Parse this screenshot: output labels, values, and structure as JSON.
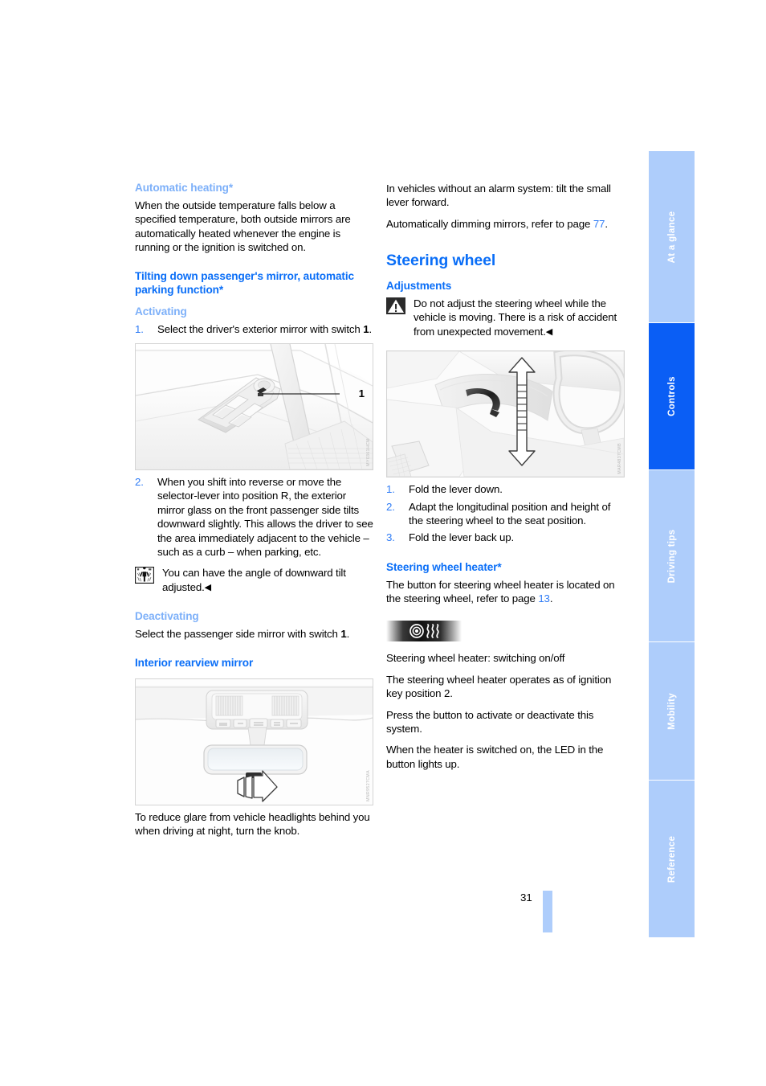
{
  "document": {
    "page_number": "31"
  },
  "tabs": [
    {
      "label": "At a glance",
      "active": false
    },
    {
      "label": "Controls",
      "active": true
    },
    {
      "label": "Driving tips",
      "active": false
    },
    {
      "label": "Mobility",
      "active": false
    },
    {
      "label": "Reference",
      "active": false
    }
  ],
  "left_column": {
    "automatic_heating": {
      "heading": "Automatic heating*",
      "body": "When the outside temperature falls below a specified temperature, both outside mirrors are automatically heated whenever the engine is running or the ignition is switched on."
    },
    "tilting": {
      "heading": "Tilting down passenger's mirror, automatic parking function*",
      "activating_heading": "Activating",
      "step1_pre": "Select the driver's exterior mirror with switch ",
      "step1_bold": "1",
      "step1_post": ".",
      "figure1_code": "MY0361HCM",
      "figure1_callout": "1",
      "step2": "When you shift into reverse or move the selector-lever into position R, the exterior mirror glass on the front passenger side tilts downward slightly. This allows the driver to see the area immediately adjacent to the vehicle – such as a curb – when parking, etc.",
      "note": "You can have the angle of downward tilt adjusted.",
      "note_icon": "service-dealer-icon",
      "deactivating_heading": "Deactivating",
      "deactivating_pre": "Select the passenger side mirror with switch ",
      "deactivating_bold": "1",
      "deactivating_post": "."
    },
    "interior_mirror": {
      "heading": "Interior rearview mirror",
      "figure2_code": "MNR9527CMA",
      "caption": "To reduce glare from vehicle headlights behind you when driving at night, turn the knob."
    }
  },
  "right_column": {
    "intro": {
      "para1": "In vehicles without an alarm system: tilt the small lever forward.",
      "para2_pre": "Automatically dimming mirrors, refer to page ",
      "para2_ref": "77",
      "para2_post": "."
    },
    "steering_wheel": {
      "title": "Steering wheel",
      "adjustments_heading": "Adjustments",
      "warning": "Do not adjust the steering wheel while the vehicle is moving. There is a risk of accident from unexpected movement.",
      "warning_icon": "warning-triangle-icon",
      "figure_code": "MAR4837CMB",
      "steps": [
        "Fold the lever down.",
        "Adapt the longitudinal position and height of the steering wheel to the seat position.",
        "Fold the lever back up."
      ]
    },
    "steering_wheel_heater": {
      "heading": "Steering wheel heater*",
      "intro_pre": "The button for steering wheel heater is located on the steering wheel, refer to page ",
      "intro_ref": "13",
      "intro_post": ".",
      "button_icon": "steering-wheel-heater-icon",
      "caption": "Steering wheel heater: switching on/off",
      "para1": "The steering wheel heater operates as of ignition key position 2.",
      "para2": "Press the button to activate or deactivate this system.",
      "para3": "When the heater is switched on, the LED in the button lights up."
    }
  },
  "colors": {
    "accent_blue": "#0a6ef7",
    "light_blue": "#7db0f9",
    "tab_inactive": "#aecdfb",
    "tab_active": "#0a5ef5"
  }
}
